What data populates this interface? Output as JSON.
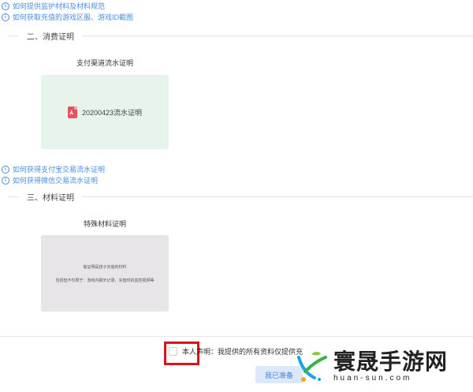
{
  "section1": {
    "links": [
      "如何提供监护材料及材料规范",
      "如何获取充值的游戏区服、游戏ID截图"
    ]
  },
  "section2": {
    "heading": "二、消费证明",
    "upload_title": "支付渠道流水证明",
    "file_name": "20200423流水证明",
    "links": [
      "如何获得支付宝交易流水证明",
      "如何获得微信交易流水证明"
    ]
  },
  "section3": {
    "heading": "三、材料证明",
    "upload_title": "特殊材料证明",
    "sample_lines": [
      "能证明是孩子充值的材料",
      "包括但不仅限于：游戏内聊天记录，充值时的监控视频等"
    ]
  },
  "footer": {
    "declaration": "本人声明：我提供的所有资料仅提供充",
    "submit_label": "我已准备"
  },
  "watermark": {
    "title": "寰晟手游网",
    "url": "huan-sun.com"
  },
  "colors": {
    "link": "#4a8de0",
    "highlight_box": "#d9141b",
    "card_green": "#e6f4ec",
    "card_gray": "#e7e5e8"
  }
}
